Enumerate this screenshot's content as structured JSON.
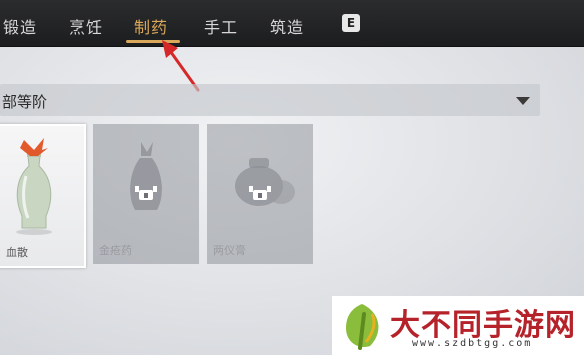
{
  "tabs": [
    {
      "label": "锻造"
    },
    {
      "label": "烹饪"
    },
    {
      "label": "制药"
    },
    {
      "label": "手工"
    },
    {
      "label": "筑造"
    }
  ],
  "tabs_key_hint": "E",
  "active_tab": "制药",
  "filter": {
    "label": "部等阶"
  },
  "cards": [
    {
      "name": "血散",
      "locked": false
    },
    {
      "name": "金疮药",
      "locked": true
    },
    {
      "name": "两仪膏",
      "locked": true
    }
  ],
  "watermark": {
    "title": "大不同手游网",
    "url": "www.szdbtgg.com"
  },
  "colors": {
    "accent": "#d9a85a",
    "arrow": "#d62828",
    "watermark": "#b5222a"
  }
}
